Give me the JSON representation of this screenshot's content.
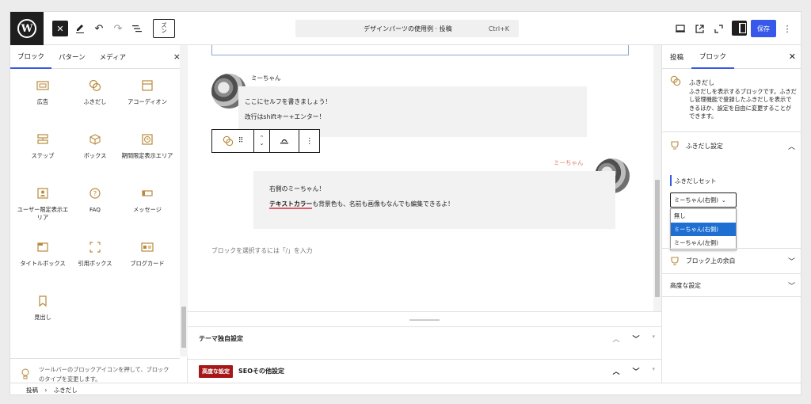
{
  "topbar": {
    "doc_title": "デザインパーツの使用例 · 投稿",
    "shortcut": "Ctrl+K",
    "save_label": "保存",
    "icons": [
      "wordpress-logo",
      "close-icon",
      "pen-icon",
      "undo-icon",
      "redo-icon",
      "list-view-icon",
      "view-icon",
      "desktop-icon",
      "external-icon",
      "fullscreen-icon",
      "settings-icon",
      "more-icon"
    ]
  },
  "inserter": {
    "tabs": [
      "ブロック",
      "パターン",
      "メディア"
    ],
    "close": "×",
    "blocks": [
      {
        "label": "広告",
        "icon": "ad-icon"
      },
      {
        "label": "ふきだし",
        "icon": "balloon-icon"
      },
      {
        "label": "アコーディオン",
        "icon": "accordion-icon"
      },
      {
        "label": "ステップ",
        "icon": "step-icon"
      },
      {
        "label": "ボックス",
        "icon": "box-icon"
      },
      {
        "label": "期間限定表示エリア",
        "icon": "timer-icon"
      },
      {
        "label": "ユーザー限定表示エリア",
        "icon": "user-icon"
      },
      {
        "label": "FAQ",
        "icon": "faq-icon"
      },
      {
        "label": "メッセージ",
        "icon": "message-icon"
      },
      {
        "label": "タイトルボックス",
        "icon": "title-box-icon"
      },
      {
        "label": "引用ボックス",
        "icon": "quote-box-icon"
      },
      {
        "label": "ブログカード",
        "icon": "blog-card-icon"
      },
      {
        "label": "見出し",
        "icon": "bookmark-icon"
      }
    ],
    "hint": "ツールバーのブロックアイコンを押して、ブロックのタイプを変更します。"
  },
  "canvas": {
    "left_balloon": {
      "name": "ミーちゃん",
      "line1": "ここにセルフを書きましょう！",
      "line2": "改行はshiftキー+エンター！"
    },
    "right_balloon": {
      "name": "ミーちゃん",
      "line1": "右側のミーちゃん！",
      "highlight": "テキストカラー",
      "line2_rest": "も背景色も、名前も画像もなんでも編集できるよ！"
    },
    "placeholder": "ブロックを選択するには「/」を入力"
  },
  "metaboxes": [
    {
      "title": "テーマ独自設定"
    },
    {
      "badge": "高度な設定",
      "title": "SEOその他設定"
    }
  ],
  "sidebar": {
    "tabs": [
      "投稿",
      "ブロック"
    ],
    "block_name": "ふきだし",
    "block_desc": "ふきだしを表示するブロックです。ふきだし管理機能で登録したふきだしを表示できるほか、設定を自由に変更することができます。",
    "panel_settings": "ふきだし設定",
    "set_label": "ふきだしセット",
    "select_value": "ミーちゃん(右側)",
    "options": [
      "無し",
      "ミーちゃん(右側)",
      "ミーちゃん(左側)"
    ],
    "panel_margin": "ブロック上の余白",
    "panel_advanced": "高度な設定"
  },
  "breadcrumb": {
    "root": "投稿",
    "sep": "›",
    "current": "ふきだし"
  },
  "colors": {
    "accent": "#3858e9",
    "icon": "#b88a3c",
    "name_right": "#e07a6a",
    "highlight_underline": "#e05a6a",
    "badge": "#a51818"
  }
}
